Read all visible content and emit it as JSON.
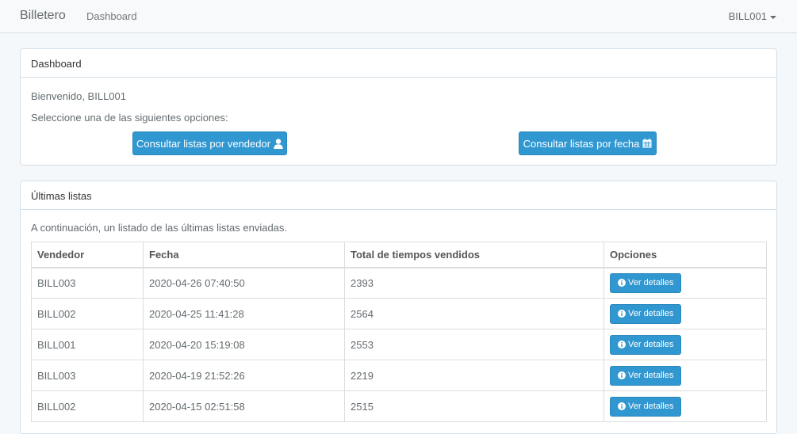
{
  "navbar": {
    "brand": "Billetero",
    "dashboard_link": "Dashboard",
    "user": "BILL001"
  },
  "dashboard_panel": {
    "heading": "Dashboard",
    "welcome": "Bienvenido, BILL001",
    "prompt": "Seleccione una de las siguientes opciones:",
    "btn_vendor": "Consultar listas por vendedor",
    "btn_vendor_icon": "user-icon",
    "btn_date": "Consultar listas por fecha",
    "btn_date_icon": "calendar-icon"
  },
  "lists_panel": {
    "heading": "Últimas listas",
    "intro": "A continuación, un listado de las últimas listas enviadas.",
    "columns": [
      "Vendedor",
      "Fecha",
      "Total de tiempos vendidos",
      "Opciones"
    ],
    "details_label": "Ver detalles",
    "details_icon": "info-circle-icon",
    "rows": [
      {
        "vendor": "BILL003",
        "date": "2020-04-26 07:40:50",
        "total": "2393"
      },
      {
        "vendor": "BILL002",
        "date": "2020-04-25 11:41:28",
        "total": "2564"
      },
      {
        "vendor": "BILL001",
        "date": "2020-04-20 15:19:08",
        "total": "2553"
      },
      {
        "vendor": "BILL003",
        "date": "2020-04-19 21:52:26",
        "total": "2219"
      },
      {
        "vendor": "BILL002",
        "date": "2020-04-15 02:51:58",
        "total": "2515"
      }
    ]
  },
  "colors": {
    "primary": "#3097d1",
    "page_bg": "#f5f8fa",
    "border": "#d3e0e9"
  }
}
